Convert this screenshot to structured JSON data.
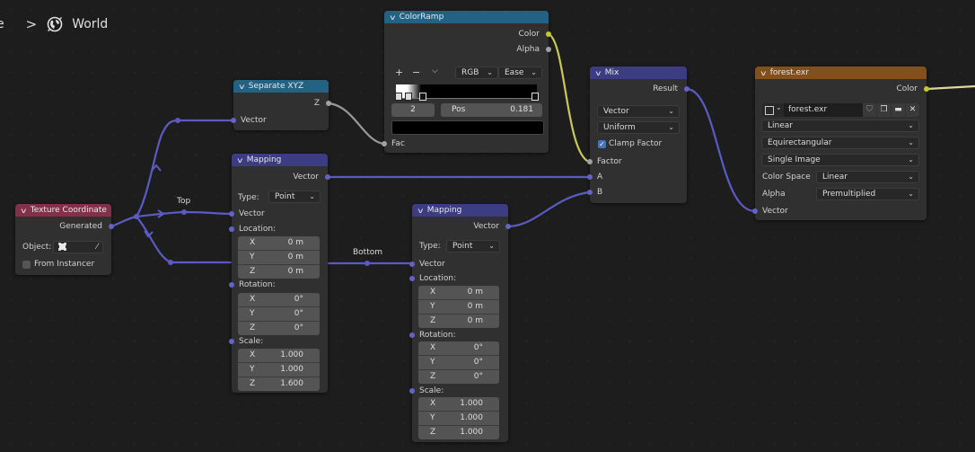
{
  "breadcrumb": {
    "previous": "e",
    "separator": ">",
    "icon": "world-globe-icon",
    "current": "World"
  },
  "reroute_labels": {
    "top": "Top",
    "bottom": "Bottom"
  },
  "nodes": {
    "texture_coordinate": {
      "title": "Texture Coordinate",
      "header_color": "#83314a",
      "output": "Generated",
      "object_label": "Object:",
      "from_instancer": "From Instancer",
      "from_instancer_checked": false
    },
    "separate_xyz": {
      "title": "Separate XYZ",
      "header_color": "#246283",
      "output": "Z",
      "input": "Vector"
    },
    "mapping1": {
      "title": "Mapping",
      "header_color": "#3c3c83",
      "output": "Vector",
      "type_label": "Type:",
      "type_value": "Point",
      "input": "Vector",
      "location_label": "Location:",
      "location": [
        {
          "k": "X",
          "v": "0 m"
        },
        {
          "k": "Y",
          "v": "0 m"
        },
        {
          "k": "Z",
          "v": "0 m"
        }
      ],
      "rotation_label": "Rotation:",
      "rotation": [
        {
          "k": "X",
          "v": "0°"
        },
        {
          "k": "Y",
          "v": "0°"
        },
        {
          "k": "Z",
          "v": "0°"
        }
      ],
      "scale_label": "Scale:",
      "scale": [
        {
          "k": "X",
          "v": "1.000"
        },
        {
          "k": "Y",
          "v": "1.000"
        },
        {
          "k": "Z",
          "v": "1.600"
        }
      ]
    },
    "mapping2": {
      "title": "Mapping",
      "header_color": "#3c3c83",
      "output": "Vector",
      "type_label": "Type:",
      "type_value": "Point",
      "input": "Vector",
      "location_label": "Location:",
      "location": [
        {
          "k": "X",
          "v": "0 m"
        },
        {
          "k": "Y",
          "v": "0 m"
        },
        {
          "k": "Z",
          "v": "0 m"
        }
      ],
      "rotation_label": "Rotation:",
      "rotation": [
        {
          "k": "X",
          "v": "0°"
        },
        {
          "k": "Y",
          "v": "0°"
        },
        {
          "k": "Z",
          "v": "0°"
        }
      ],
      "scale_label": "Scale:",
      "scale": [
        {
          "k": "X",
          "v": "1.000"
        },
        {
          "k": "Y",
          "v": "1.000"
        },
        {
          "k": "Z",
          "v": "1.000"
        }
      ]
    },
    "color_ramp": {
      "title": "ColorRamp",
      "header_color": "#246283",
      "outputs": [
        "Color",
        "Alpha"
      ],
      "add": "+",
      "remove": "−",
      "menu": "⌵",
      "color_mode": "RGB",
      "interpolation": "Ease",
      "stop_index": "2",
      "pos_label": "Pos",
      "pos_value": "0.181",
      "stop_color": "#000000",
      "input": "Fac"
    },
    "mix": {
      "title": "Mix",
      "header_color": "#3c3c83",
      "output": "Result",
      "data_type": "Vector",
      "factor_mode": "Uniform",
      "clamp_label": "Clamp Factor",
      "clamp_checked": true,
      "inputs": [
        "Factor",
        "A",
        "B"
      ]
    },
    "env_texture": {
      "title": "forest.exr",
      "header_color": "#83501c",
      "output": "Color",
      "image_name": "forest.exr",
      "interpolation": "Linear",
      "projection": "Equirectangular",
      "source": "Single Image",
      "color_space_label": "Color Space",
      "color_space": "Linear",
      "alpha_label": "Alpha",
      "alpha": "Premultiplied",
      "input": "Vector"
    }
  },
  "colors": {
    "vector_socket": "#6363c7",
    "color_socket": "#c7c729",
    "float_socket": "#a1a1a1",
    "vector_wire": "#5b5bc4"
  }
}
